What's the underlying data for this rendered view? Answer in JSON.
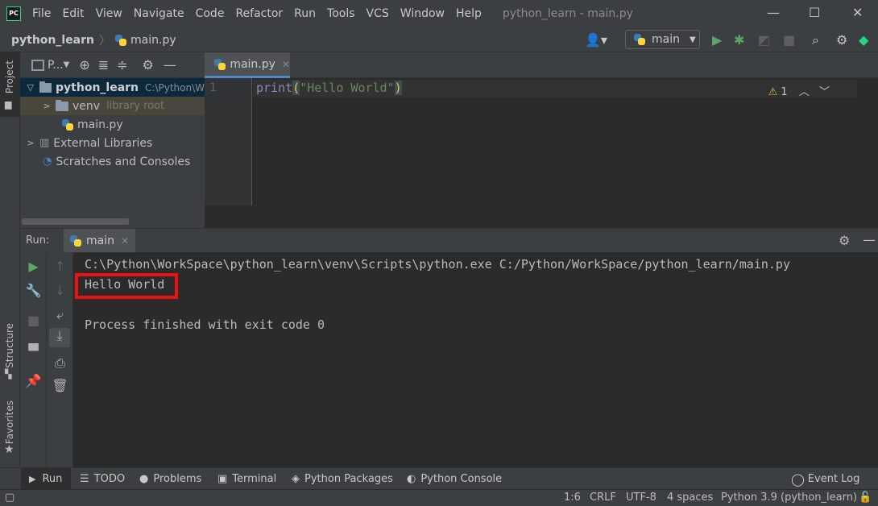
{
  "app": {
    "logo_text": "PC",
    "window_title": "python_learn - main.py"
  },
  "menu": [
    "File",
    "Edit",
    "View",
    "Navigate",
    "Code",
    "Refactor",
    "Run",
    "Tools",
    "VCS",
    "Window",
    "Help"
  ],
  "navbar": {
    "project": "python_learn",
    "file": "main.py",
    "run_config": "main"
  },
  "project_panel": {
    "header_label": "P...",
    "side_label": "Project",
    "tree": [
      {
        "label": "python_learn",
        "path": "C:\\Python\\W",
        "bold": true
      },
      {
        "label": "venv",
        "hint": "library root"
      },
      {
        "label": "main.py"
      },
      {
        "label": "External Libraries"
      },
      {
        "label": "Scratches and Consoles"
      }
    ]
  },
  "editor": {
    "tab": "main.py",
    "line_number": "1",
    "code": {
      "keyword": "print",
      "open": "(",
      "string": "\"Hello World\"",
      "close": ")"
    },
    "warnings": "1"
  },
  "run_panel": {
    "label": "Run:",
    "tab": "main",
    "console_lines": [
      "C:\\Python\\WorkSpace\\python_learn\\venv\\Scripts\\python.exe C:/Python/WorkSpace/python_learn/main.py",
      "Hello World",
      "",
      "Process finished with exit code 0"
    ]
  },
  "side_labels": {
    "structure": "Structure",
    "favorites": "Favorites"
  },
  "bottom_tools": [
    "Run",
    "TODO",
    "Problems",
    "Terminal",
    "Python Packages",
    "Python Console"
  ],
  "event_log": "Event Log",
  "status": {
    "position": "1:6",
    "line_sep": "CRLF",
    "encoding": "UTF-8",
    "indent": "4 spaces",
    "interpreter": "Python 3.9 (python_learn)"
  },
  "colors": {
    "highlight_box": "#ee1111",
    "run_green": "#59a869"
  }
}
